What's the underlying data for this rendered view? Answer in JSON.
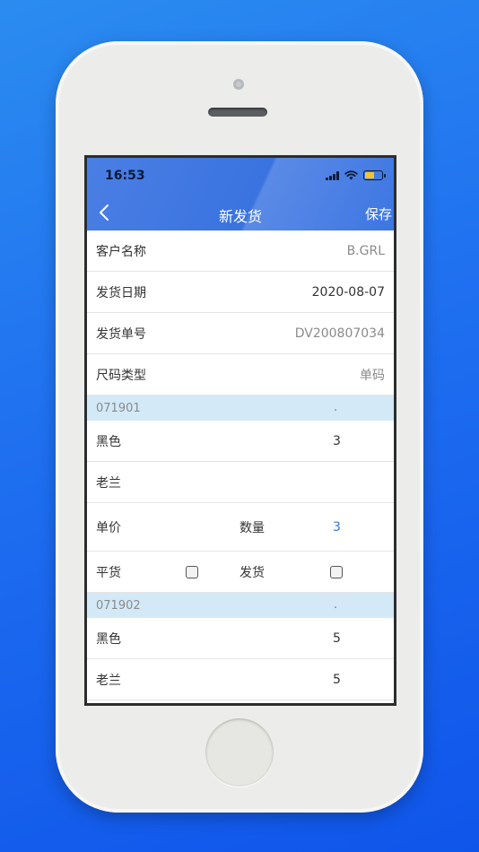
{
  "status_bar": {
    "time": "16:53"
  },
  "nav": {
    "title": "新发货",
    "save_label": "保存"
  },
  "form": {
    "customer_name": {
      "label": "客户名称",
      "value": "B.GRL"
    },
    "ship_date": {
      "label": "发货日期",
      "value": "2020-08-07"
    },
    "ship_number": {
      "label": "发货单号",
      "value": "DV200807034"
    },
    "size_type": {
      "label": "尺码类型",
      "value": "单码"
    }
  },
  "items": [
    {
      "code": "071901",
      "dot": ".",
      "color_label": "黑色",
      "color_qty": "3",
      "name": "老兰",
      "price_label": "单价",
      "qty_label": "数量",
      "qty_value": "3",
      "flat_label": "平货",
      "ship_label": "发货"
    },
    {
      "code": "071902",
      "dot": ".",
      "color_label": "黑色",
      "color_qty": "5",
      "name": "老兰",
      "name_qty": "5"
    }
  ]
}
